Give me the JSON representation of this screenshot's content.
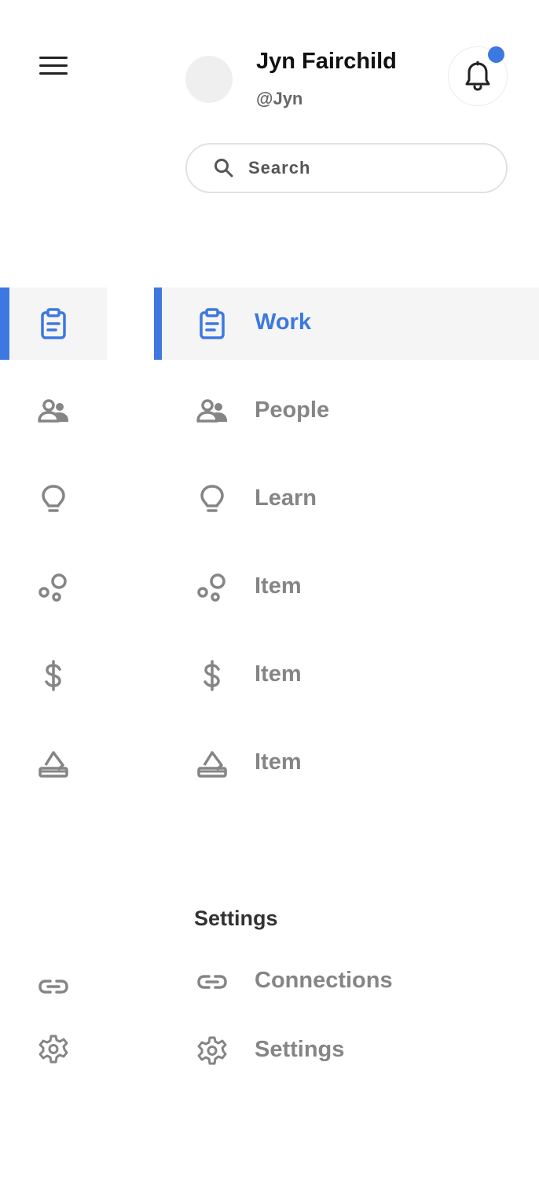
{
  "header": {
    "user_name": "Jyn Fairchild",
    "user_handle": "@Jyn",
    "notification_dot_color": "#3d78e0"
  },
  "search": {
    "placeholder": "Search",
    "value": ""
  },
  "nav": {
    "items": [
      {
        "label": "Work",
        "icon": "clipboard-icon",
        "active": true
      },
      {
        "label": "People",
        "icon": "people-icon",
        "active": false
      },
      {
        "label": "Learn",
        "icon": "lightbulb-icon",
        "active": false
      },
      {
        "label": "Item",
        "icon": "bubbles-icon",
        "active": false
      },
      {
        "label": "Item",
        "icon": "dollar-icon",
        "active": false
      },
      {
        "label": "Item",
        "icon": "eraser-icon",
        "active": false
      }
    ]
  },
  "settings_section": {
    "title": "Settings",
    "items": [
      {
        "label": "Connections",
        "icon": "link-icon"
      },
      {
        "label": "Settings",
        "icon": "gear-icon"
      }
    ]
  },
  "colors": {
    "accent": "#3d78e0",
    "active_bg": "#f5f5f5",
    "inactive_text": "#858585"
  }
}
